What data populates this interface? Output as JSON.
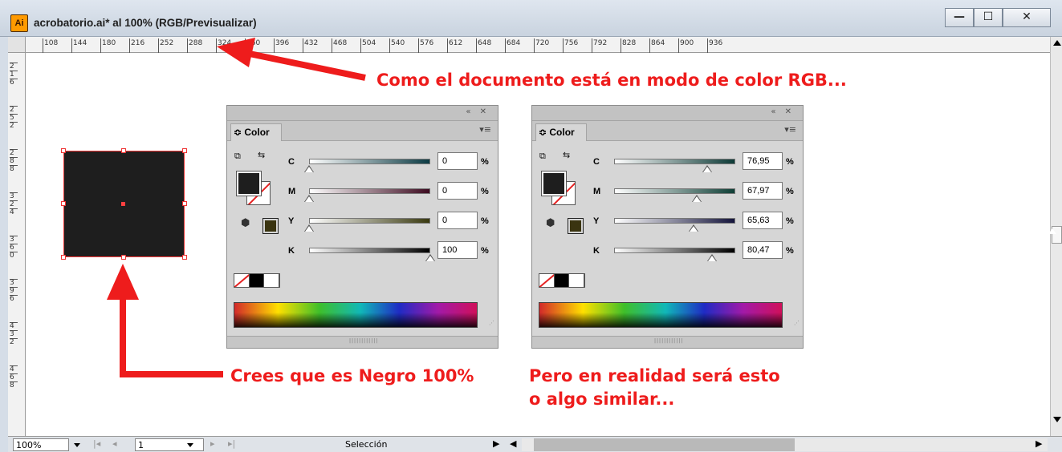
{
  "window": {
    "title": "acrobatorio.ai* al 100% (RGB/Previsualizar)",
    "app_icon_label": "Ai",
    "buttons": {
      "minimize": "—",
      "maximize": "☐",
      "close": "✕"
    }
  },
  "ruler": {
    "top_ticks": [
      "108",
      "144",
      "180",
      "216",
      "252",
      "288",
      "324",
      "360",
      "396",
      "432",
      "468",
      "504",
      "540",
      "576",
      "612",
      "648",
      "684",
      "720",
      "756",
      "792",
      "828",
      "864",
      "900",
      "936"
    ],
    "left_ticks": [
      "2",
      "1",
      "6",
      "2",
      "5",
      "2",
      "2",
      "8",
      "8",
      "3",
      "2",
      "4",
      "3",
      "6",
      "0",
      "3",
      "9",
      "6",
      "4",
      "3",
      "2",
      "4",
      "6",
      "8"
    ]
  },
  "annotations": {
    "top": "Como el documento está en modo de color RGB...",
    "bottom_left": "Crees que es Negro 100%",
    "bottom_right_line1": "Pero en realidad será esto",
    "bottom_right_line2": "o algo similar..."
  },
  "panels": [
    {
      "tab_label": "≎ Color",
      "header_controls": "«  ✕",
      "menu_glyph": "▾≡",
      "rows": [
        {
          "letter": "C",
          "value": "0",
          "unit": "%",
          "fraction": 0.0,
          "gradient_end": "#0c3b44"
        },
        {
          "letter": "M",
          "value": "0",
          "unit": "%",
          "fraction": 0.0,
          "gradient_end": "#3d0b20"
        },
        {
          "letter": "Y",
          "value": "0",
          "unit": "%",
          "fraction": 0.0,
          "gradient_end": "#3a3a10"
        },
        {
          "letter": "K",
          "value": "100",
          "unit": "%",
          "fraction": 1.0,
          "gradient_end": "#000000"
        }
      ],
      "oog_color": "#3a3410"
    },
    {
      "tab_label": "≎ Color",
      "header_controls": "«  ✕",
      "menu_glyph": "▾≡",
      "rows": [
        {
          "letter": "C",
          "value": "76,95",
          "unit": "%",
          "fraction": 0.7695,
          "gradient_end": "#0d3a36"
        },
        {
          "letter": "M",
          "value": "67,97",
          "unit": "%",
          "fraction": 0.6797,
          "gradient_end": "#0f3f36"
        },
        {
          "letter": "Y",
          "value": "65,63",
          "unit": "%",
          "fraction": 0.6563,
          "gradient_end": "#15153c"
        },
        {
          "letter": "K",
          "value": "80,47",
          "unit": "%",
          "fraction": 0.8047,
          "gradient_end": "#000000"
        }
      ],
      "oog_color": "#3a3410"
    }
  ],
  "statusbar": {
    "zoom": "100%",
    "page": "1",
    "tool": "Selección",
    "nav_first": "|◂",
    "nav_prev": "◂",
    "nav_next": "▸",
    "nav_last": "▸|"
  },
  "colors": {
    "annotation_red": "#ee1c1c",
    "object_fill": "#1e1e1e",
    "selection": "#ff3b3b"
  }
}
